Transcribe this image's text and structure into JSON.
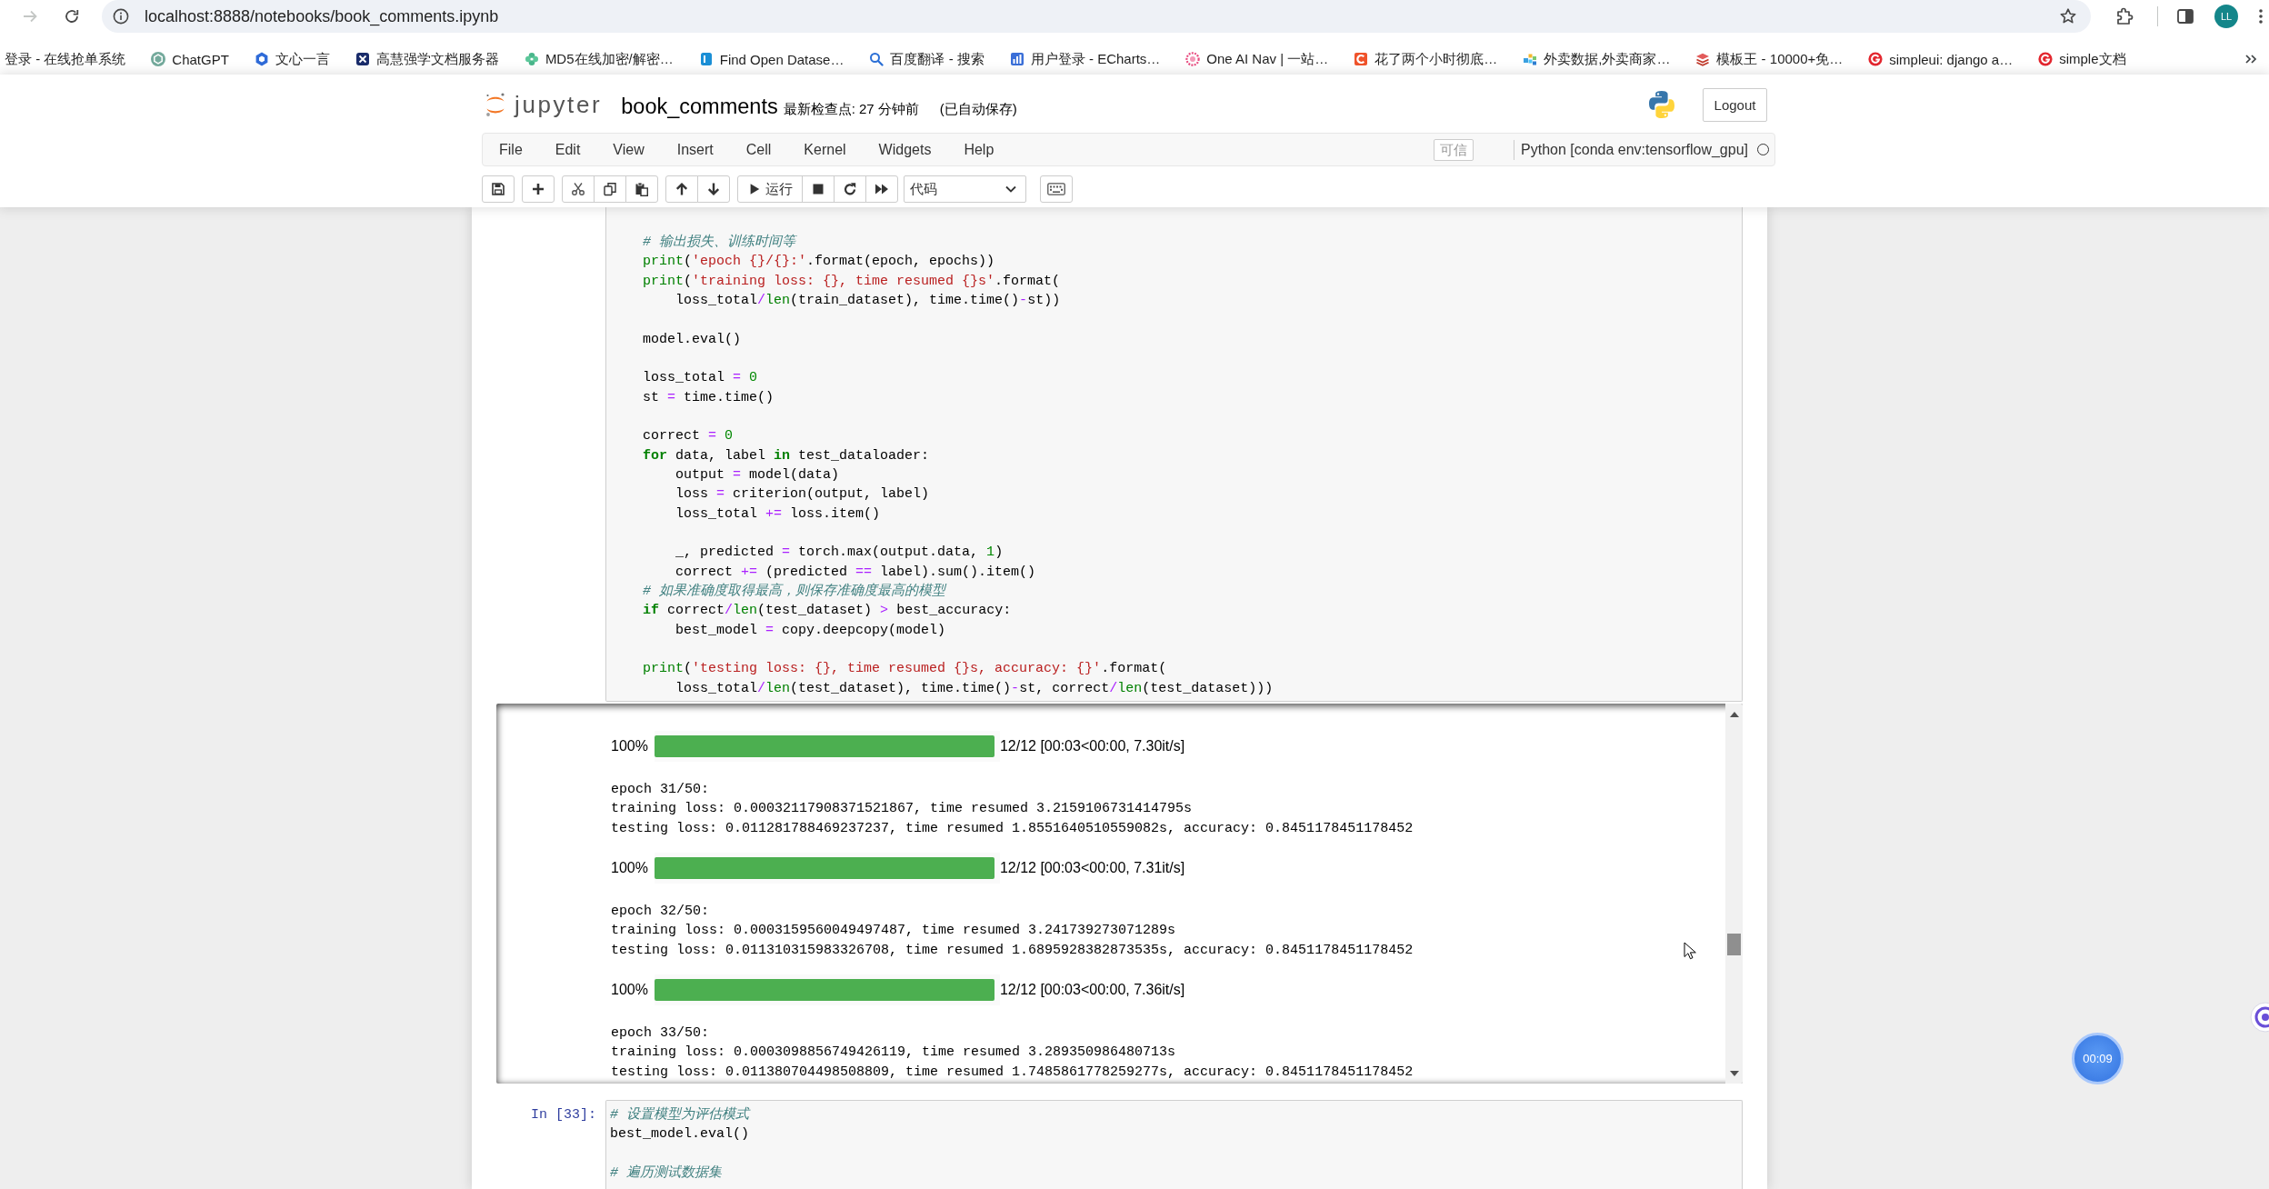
{
  "browser": {
    "forward_disabled": true,
    "address": "localhost:8888/notebooks/book_comments.ipynb",
    "profile_initials": "LL"
  },
  "bookmarks": [
    {
      "label": "登录 - 在线抢单系统"
    },
    {
      "label": "ChatGPT"
    },
    {
      "label": "文心一言"
    },
    {
      "label": "高慧强学文档服务器"
    },
    {
      "label": "MD5在线加密/解密…"
    },
    {
      "label": "Find Open Datase…"
    },
    {
      "label": "百度翻译 - 搜索"
    },
    {
      "label": "用户登录 - ECharts…"
    },
    {
      "label": "One AI Nav | 一站…"
    },
    {
      "label": "花了两个小时彻底…"
    },
    {
      "label": "外卖数据,外卖商家…"
    },
    {
      "label": "模板王 - 10000+免…"
    },
    {
      "label": "simpleui: django a…"
    },
    {
      "label": "simple文档"
    }
  ],
  "header": {
    "logo_text": "jupyter",
    "notebook_name": "book_comments",
    "checkpoint": "最新检查点: 27 分钟前",
    "autosave": "(已自动保存)",
    "logout": "Logout"
  },
  "menu": [
    "File",
    "Edit",
    "View",
    "Insert",
    "Cell",
    "Kernel",
    "Widgets",
    "Help"
  ],
  "trusted": "可信",
  "kernel": {
    "name": "Python [conda env:tensorflow_gpu]",
    "busy": false
  },
  "toolbar": {
    "run_label": "运行",
    "cell_type": "代码"
  },
  "cells": [
    {
      "paragraphs": [
        [
          [
            {
              "kind": "comment",
              "text": "    # 输出损失、训练时间等"
            }
          ],
          [
            {
              "kind": "builtin",
              "text": "    print"
            },
            {
              "kind": "plain",
              "text": "("
            },
            {
              "kind": "string",
              "text": "'epoch {}/{}:'"
            },
            {
              "kind": "plain",
              "text": ".format(epoch, epochs))"
            }
          ],
          [
            {
              "kind": "builtin",
              "text": "    print"
            },
            {
              "kind": "plain",
              "text": "("
            },
            {
              "kind": "string",
              "text": "'training loss: {}, time resumed {}s'"
            },
            {
              "kind": "plain",
              "text": ".format("
            }
          ],
          [
            {
              "kind": "plain",
              "text": "        loss_total"
            },
            {
              "kind": "operator",
              "text": "/"
            },
            {
              "kind": "builtin",
              "text": "len"
            },
            {
              "kind": "plain",
              "text": "(train_dataset), time.time()"
            },
            {
              "kind": "operator",
              "text": "-"
            },
            {
              "kind": "plain",
              "text": "st))"
            }
          ]
        ],
        [
          [
            {
              "kind": "plain",
              "text": "    model.eval()"
            }
          ]
        ],
        [
          [
            {
              "kind": "plain",
              "text": "    loss_total "
            },
            {
              "kind": "operator",
              "text": "="
            },
            {
              "kind": "number",
              "text": " 0"
            }
          ],
          [
            {
              "kind": "plain",
              "text": "    st "
            },
            {
              "kind": "operator",
              "text": "="
            },
            {
              "kind": "plain",
              "text": " time.time()"
            }
          ]
        ],
        [
          [
            {
              "kind": "plain",
              "text": "    correct "
            },
            {
              "kind": "operator",
              "text": "="
            },
            {
              "kind": "number",
              "text": " 0"
            }
          ],
          [
            {
              "kind": "keyword",
              "text": "    for"
            },
            {
              "kind": "plain",
              "text": " data, label "
            },
            {
              "kind": "keyword",
              "text": "in"
            },
            {
              "kind": "plain",
              "text": " test_dataloader:"
            }
          ],
          [
            {
              "kind": "plain",
              "text": "        output "
            },
            {
              "kind": "operator",
              "text": "="
            },
            {
              "kind": "plain",
              "text": " model(data)"
            }
          ],
          [
            {
              "kind": "plain",
              "text": "        loss "
            },
            {
              "kind": "operator",
              "text": "="
            },
            {
              "kind": "plain",
              "text": " criterion(output, label)"
            }
          ],
          [
            {
              "kind": "plain",
              "text": "        loss_total "
            },
            {
              "kind": "operator",
              "text": "+="
            },
            {
              "kind": "plain",
              "text": " loss.item()"
            }
          ]
        ],
        [
          [
            {
              "kind": "plain",
              "text": "        _, predicted "
            },
            {
              "kind": "operator",
              "text": "="
            },
            {
              "kind": "plain",
              "text": " torch.max(output.data, "
            },
            {
              "kind": "number",
              "text": "1"
            },
            {
              "kind": "plain",
              "text": ")"
            }
          ],
          [
            {
              "kind": "plain",
              "text": "        correct "
            },
            {
              "kind": "operator",
              "text": "+="
            },
            {
              "kind": "plain",
              "text": " (predicted "
            },
            {
              "kind": "operator",
              "text": "=="
            },
            {
              "kind": "plain",
              "text": " label).sum().item()"
            }
          ],
          [
            {
              "kind": "comment",
              "text": "    # 如果准确度取得最高，则保存准确度最高的模型"
            }
          ],
          [
            {
              "kind": "keyword",
              "text": "    if"
            },
            {
              "kind": "plain",
              "text": " correct"
            },
            {
              "kind": "operator",
              "text": "/"
            },
            {
              "kind": "builtin",
              "text": "len"
            },
            {
              "kind": "plain",
              "text": "(test_dataset) "
            },
            {
              "kind": "operator",
              "text": ">"
            },
            {
              "kind": "plain",
              "text": " best_accuracy:"
            }
          ],
          [
            {
              "kind": "plain",
              "text": "        best_model "
            },
            {
              "kind": "operator",
              "text": "="
            },
            {
              "kind": "plain",
              "text": " copy.deepcopy(model)"
            }
          ]
        ],
        [
          [
            {
              "kind": "builtin",
              "text": "    print"
            },
            {
              "kind": "plain",
              "text": "("
            },
            {
              "kind": "string",
              "text": "'testing loss: {}, time resumed {}s, accuracy: {}'"
            },
            {
              "kind": "plain",
              "text": ".format("
            }
          ],
          [
            {
              "kind": "plain",
              "text": "        loss_total"
            },
            {
              "kind": "operator",
              "text": "/"
            },
            {
              "kind": "builtin",
              "text": "len"
            },
            {
              "kind": "plain",
              "text": "(test_dataset), time.time()"
            },
            {
              "kind": "operator",
              "text": "-"
            },
            {
              "kind": "plain",
              "text": "st, correct"
            },
            {
              "kind": "operator",
              "text": "/"
            },
            {
              "kind": "builtin",
              "text": "len"
            },
            {
              "kind": "plain",
              "text": "(test_dataset)))"
            }
          ]
        ]
      ],
      "output": {
        "scrolled": true,
        "items": [
          {
            "kind": "progress",
            "percent": "100%",
            "level": 1,
            "detail": "12/12 [00:03<00:00, 7.30it/s]"
          },
          {
            "kind": "text",
            "lines": [
              "epoch 31/50:",
              "training loss: 0.00032117908371521867, time resumed 3.2159106731414795s",
              "testing loss: 0.011281788469237237, time resumed 1.8551640510559082s, accuracy: 0.8451178451178452"
            ]
          },
          {
            "kind": "progress",
            "percent": "100%",
            "level": 1,
            "detail": "12/12 [00:03<00:00, 7.31it/s]"
          },
          {
            "kind": "text",
            "lines": [
              "epoch 32/50:",
              "training loss: 0.0003159560049497487, time resumed 3.241739273071289s",
              "testing loss: 0.011310315983326708, time resumed 1.6895928382873535s, accuracy: 0.8451178451178452"
            ]
          },
          {
            "kind": "progress",
            "percent": "100%",
            "level": 1,
            "detail": "12/12 [00:03<00:00, 7.36it/s]"
          },
          {
            "kind": "text",
            "lines": [
              "epoch 33/50:",
              "training loss: 0.0003098856749426119, time resumed 3.289350986480713s",
              "testing loss: 0.011380704498508809, time resumed 1.7485861778259277s, accuracy: 0.8451178451178452"
            ]
          }
        ]
      }
    },
    {
      "prompt": "In [33]:",
      "paragraphs": [
        [
          [
            {
              "kind": "comment",
              "text": "# 设置模型为评估模式"
            }
          ],
          [
            {
              "kind": "plain",
              "text": "best_model.eval()"
            }
          ]
        ],
        [
          [
            {
              "kind": "comment",
              "text": "# 遍历测试数据集"
            }
          ]
        ]
      ]
    }
  ],
  "timer": "00:09"
}
